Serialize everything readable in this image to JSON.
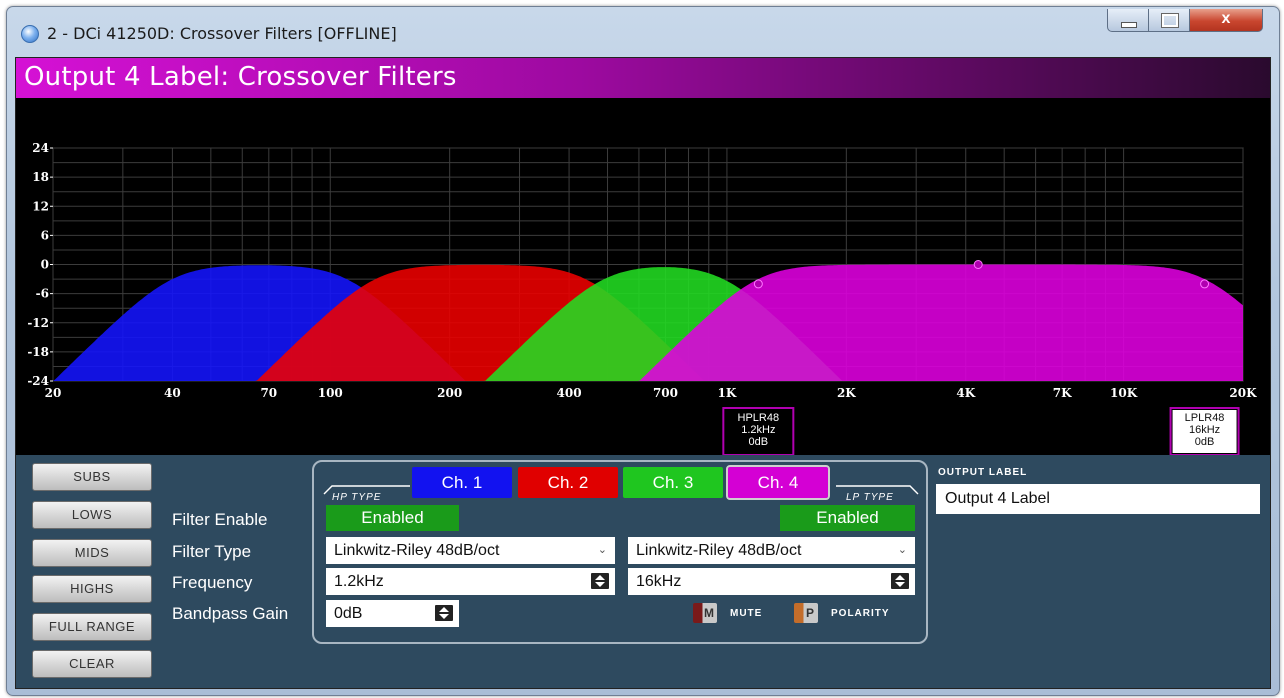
{
  "window": {
    "title": "2 - DCi 41250D: Crossover Filters [OFFLINE]",
    "close_label": "x"
  },
  "header": {
    "title": "Output 4 Label: Crossover Filters"
  },
  "graph": {
    "y_ticks": [
      "24",
      "18",
      "12",
      "6",
      "0",
      "-6",
      "-12",
      "-18",
      "-24"
    ],
    "x_ticks": [
      "20",
      "40",
      "70",
      "100",
      "200",
      "400",
      "700",
      "1K",
      "2K",
      "4K",
      "7K",
      "10K",
      "20K"
    ],
    "markers": [
      {
        "lines": [
          "HPLR48",
          "1.2kHz",
          "0dB"
        ]
      },
      {
        "lines": [
          "LPLR48",
          "16kHz",
          "0dB"
        ]
      }
    ],
    "colors": {
      "ch1": "#1515ff",
      "ch2": "#ee0000",
      "ch3": "#22dd22",
      "ch4": "#e000e0",
      "overlap": "#c4109a"
    }
  },
  "sidebar": {
    "buttons": [
      "SUBS",
      "LOWS",
      "MIDS",
      "HIGHS",
      "FULL RANGE",
      "CLEAR"
    ]
  },
  "labels": {
    "filter_enable": "Filter Enable",
    "filter_type": "Filter Type",
    "frequency": "Frequency",
    "bandpass_gain": "Bandpass Gain"
  },
  "channels": [
    {
      "label": "Ch. 1",
      "color": "#1212f0"
    },
    {
      "label": "Ch. 2",
      "color": "#e00000"
    },
    {
      "label": "Ch. 3",
      "color": "#1fc61f"
    },
    {
      "label": "Ch. 4",
      "color": "#d400d4"
    }
  ],
  "hp": {
    "type_tag": "HP TYPE",
    "enabled": "Enabled",
    "filter_type": "Linkwitz-Riley 48dB/oct",
    "frequency": "1.2kHz",
    "gain": "0dB"
  },
  "lp": {
    "type_tag": "LP TYPE",
    "enabled": "Enabled",
    "filter_type": "Linkwitz-Riley 48dB/oct",
    "frequency": "16kHz"
  },
  "controls": {
    "mute_icon": "M",
    "mute_label": "MUTE",
    "polarity_icon": "P",
    "polarity_label": "POLARITY"
  },
  "output_label": {
    "title": "OUTPUT LABEL",
    "value": "Output 4 Label"
  }
}
